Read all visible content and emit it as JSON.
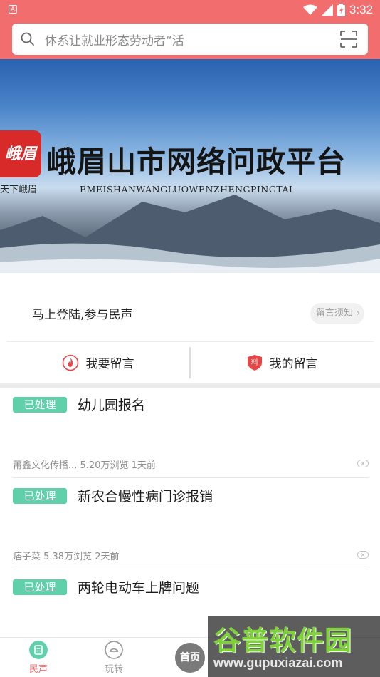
{
  "status_bar": {
    "left_icon_letter": "A",
    "time": "3:32"
  },
  "search": {
    "placeholder": "体系让就业形态劳动者“活",
    "icon": "search-icon",
    "scan_icon": "scan-icon"
  },
  "banner": {
    "logo_text": "峨眉",
    "logo_sub": "天下峨眉",
    "title": "峨眉山市网络问政平台",
    "subtitle": "EMEISHANWANGLUOWENZHENGPINGTAI"
  },
  "login": {
    "prompt": "马上登陆,参与民声",
    "notice_button": "留言须知",
    "notice_chevron": "›"
  },
  "actions": {
    "leave_message": "我要留言",
    "my_messages": "我的留言"
  },
  "list": {
    "items": [
      {
        "status": "已处理",
        "title": "幼儿园报名",
        "meta": "莆鑫文化传播... 5.20万浏览 1天前"
      },
      {
        "status": "已处理",
        "title": "新农合慢性病门诊报销",
        "meta": "痞子菜 5.38万浏览 2天前"
      },
      {
        "status": "已处理",
        "title": "两轮电动车上牌问题",
        "meta": ""
      }
    ]
  },
  "bottom_nav": {
    "items": [
      {
        "label": "民声",
        "icon": "voice-icon",
        "active": true
      },
      {
        "label": "玩转",
        "icon": "explore-icon",
        "active": false
      }
    ],
    "home_label": "首页"
  },
  "watermark": {
    "title": "谷普软件园",
    "url": "www.gupuxiazai.com"
  },
  "colors": {
    "brand": "#f26e6e",
    "badge": "#5fd0a9",
    "nav_active": "#f26e6e",
    "nav_inactive": "#9a9a9a"
  }
}
